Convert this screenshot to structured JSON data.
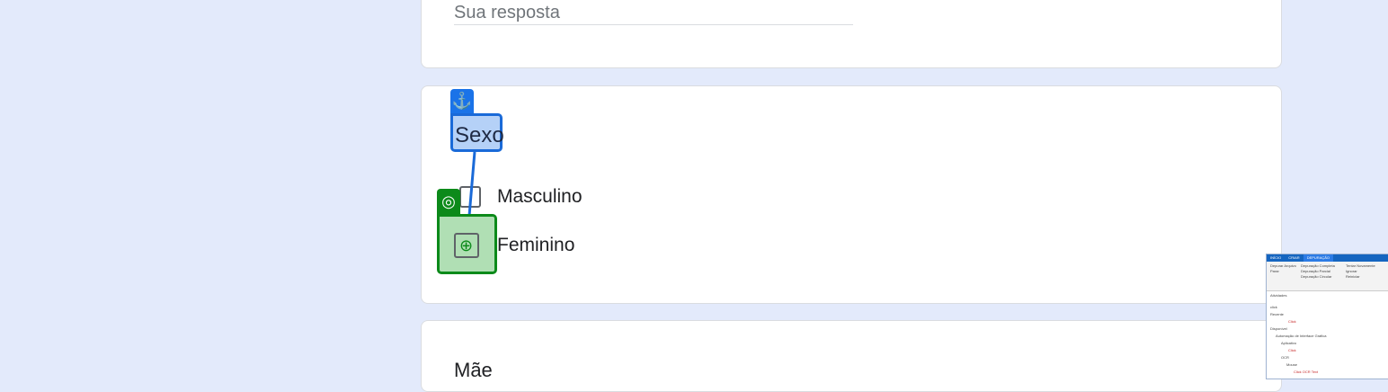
{
  "form": {
    "answer_placeholder": "Sua resposta",
    "question_sexo": {
      "options": [
        {
          "label": "Masculino"
        },
        {
          "label": "Feminino"
        }
      ]
    },
    "next_question_title": "Mãe"
  },
  "overlay": {
    "anchor_label": "Sexo",
    "anchor_icon": "anchor-icon",
    "target_icon": "target-icon",
    "anchor_color": "#1a6ad8",
    "target_color": "#0c8a1a"
  },
  "studio_thumbnail": {
    "tabs": [
      "INÍCIO",
      "CRIAR",
      "DEPURAÇÃO"
    ],
    "ribbon": [
      "Depurar Arquivo",
      "Parar",
      "Depuração Completa",
      "Depuração Parcial",
      "Depuração Circular",
      "Tentar Novamente",
      "Ignorar",
      "Reiniciar"
    ],
    "panel_title": "Atividades",
    "search_value": "click",
    "tree": [
      "Recente",
      "Click",
      "Disponível",
      "Automação de Interface Gráfica",
      "Aplicativo",
      "Click",
      "OCR",
      "Mouse",
      "Click OCR Text"
    ]
  }
}
